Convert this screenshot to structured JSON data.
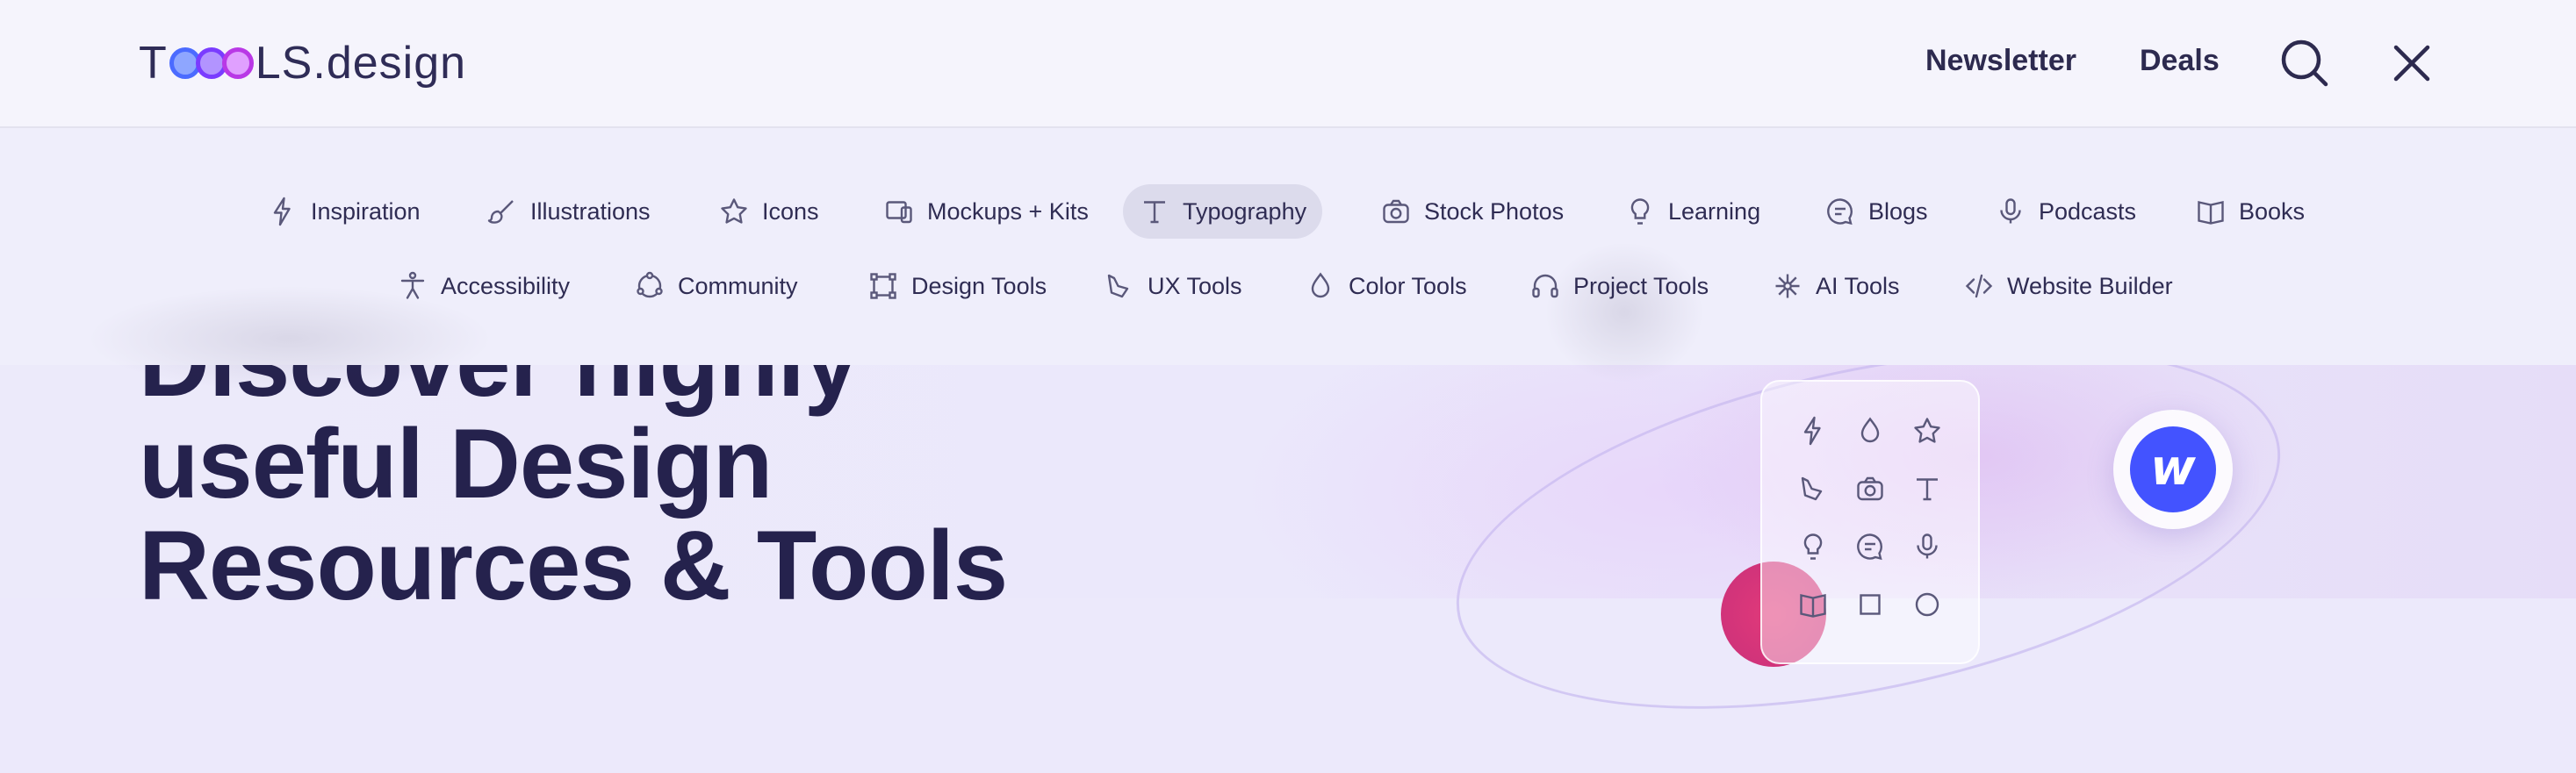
{
  "logo": {
    "text_before": "T",
    "text_after": "LS.design"
  },
  "header": {
    "links": [
      "Newsletter",
      "Deals"
    ],
    "search_icon": "search-icon",
    "close_icon": "close-icon"
  },
  "menu": {
    "row1": [
      {
        "label": "Inspiration",
        "icon": "lightning-icon"
      },
      {
        "label": "Illustrations",
        "icon": "brush-icon"
      },
      {
        "label": "Icons",
        "icon": "star-icon"
      },
      {
        "label": "Mockups + Kits",
        "icon": "devices-icon"
      },
      {
        "label": "Typography",
        "icon": "type-icon",
        "active": true
      },
      {
        "label": "Stock Photos",
        "icon": "camera-icon"
      },
      {
        "label": "Learning",
        "icon": "lightbulb-icon"
      },
      {
        "label": "Blogs",
        "icon": "chat-icon"
      },
      {
        "label": "Podcasts",
        "icon": "microphone-icon"
      },
      {
        "label": "Books",
        "icon": "book-icon"
      }
    ],
    "row2": [
      {
        "label": "Accessibility",
        "icon": "accessibility-icon"
      },
      {
        "label": "Community",
        "icon": "community-icon"
      },
      {
        "label": "Design Tools",
        "icon": "vector-icon"
      },
      {
        "label": "UX Tools",
        "icon": "pointer-icon"
      },
      {
        "label": "Color Tools",
        "icon": "drop-icon"
      },
      {
        "label": "Project Tools",
        "icon": "headphones-icon"
      },
      {
        "label": "AI Tools",
        "icon": "ai-icon"
      },
      {
        "label": "Website Builder",
        "icon": "code-icon"
      }
    ]
  },
  "hero": {
    "title_lines": [
      "Discover highly",
      "useful Design",
      "Resources & Tools"
    ],
    "badge_letter": "w"
  },
  "colors": {
    "text": "#2f2c53",
    "accent_blue": "#4353ff",
    "active_pill": "#dcdbec"
  }
}
